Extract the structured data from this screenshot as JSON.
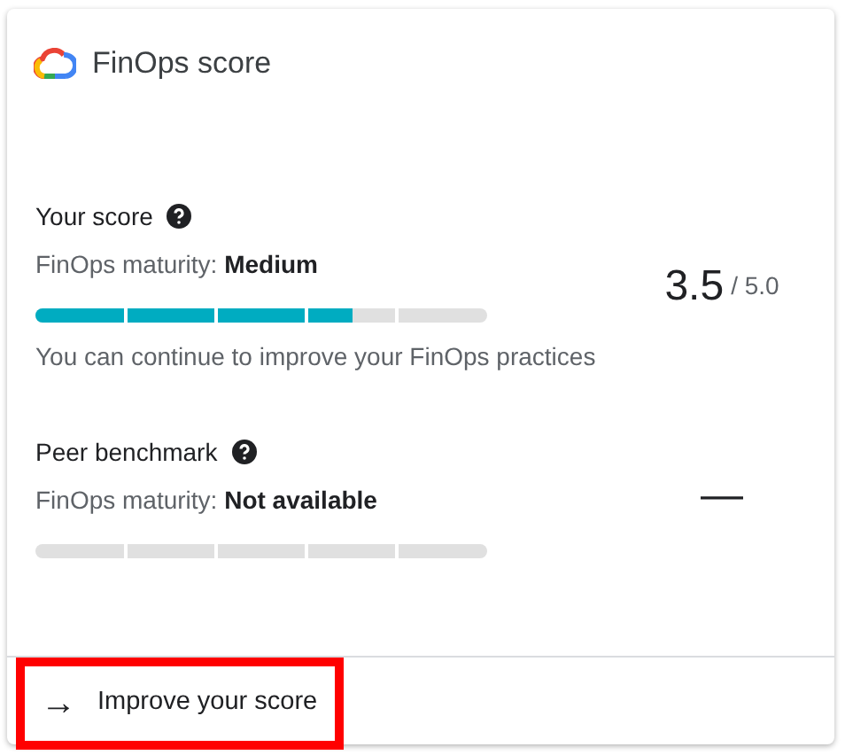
{
  "card": {
    "title": "FinOps score"
  },
  "sections": [
    {
      "label": "Your score",
      "maturity_label": "FinOps maturity:",
      "maturity_value": "Medium",
      "level": 0.7,
      "score": "3.5",
      "score_max": "/ 5.0",
      "note": "You can continue to improve your FinOps practices"
    },
    {
      "label": "Peer benchmark",
      "maturity_label": "FinOps maturity:",
      "maturity_value": "Not available",
      "score": "—"
    }
  ],
  "footer": {
    "link": "Improve your score",
    "arrow": "→",
    "highlighted": true
  }
}
